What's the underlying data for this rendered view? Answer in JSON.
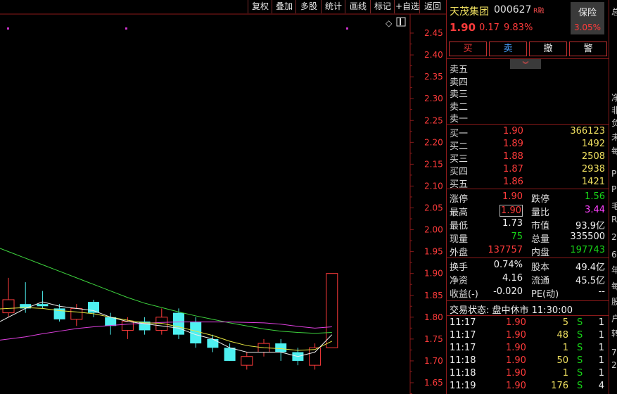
{
  "toolbar": {
    "buttons": [
      "复权",
      "叠加",
      "多股",
      "统计",
      "画线",
      "标记",
      "+自选",
      "返回"
    ]
  },
  "stock": {
    "name": "天茂集团",
    "code": "000627",
    "tag": "R融",
    "badge": "保险",
    "badge_pct": "3.05%",
    "price": "1.90",
    "change": "0.17",
    "change_pct": "9.83%"
  },
  "trade_buttons": [
    "买",
    "卖",
    "撤",
    "警"
  ],
  "order_book": {
    "asks": [
      "卖五",
      "卖四",
      "卖三",
      "卖二",
      "卖一"
    ],
    "bids": [
      {
        "label": "买一",
        "price": "1.90",
        "vol": "366123"
      },
      {
        "label": "买二",
        "price": "1.89",
        "vol": "1492"
      },
      {
        "label": "买三",
        "price": "1.88",
        "vol": "2508"
      },
      {
        "label": "买四",
        "price": "1.87",
        "vol": "2938"
      },
      {
        "label": "买五",
        "price": "1.86",
        "vol": "1421"
      }
    ]
  },
  "stats": [
    {
      "l1": "涨停",
      "v1": "1.90",
      "c1": "red",
      "l2": "跌停",
      "v2": "1.56",
      "c2": "green"
    },
    {
      "l1": "最高",
      "v1": "1.90",
      "c1": "red",
      "l2": "量比",
      "v2": "3.44",
      "c2": "magenta"
    },
    {
      "l1": "最低",
      "v1": "1.73",
      "c1": "white",
      "l2": "市值",
      "v2": "93.9亿",
      "c2": "white"
    },
    {
      "l1": "现量",
      "v1": "75",
      "c1": "green",
      "l2": "总量",
      "v2": "335500",
      "c2": "white"
    },
    {
      "l1": "外盘",
      "v1": "137757",
      "c1": "red",
      "l2": "内盘",
      "v2": "197743",
      "c2": "green"
    }
  ],
  "fund": [
    {
      "l1": "换手",
      "v1": "0.74%",
      "l2": "股本",
      "v2": "49.4亿"
    },
    {
      "l1": "净资",
      "v1": "4.16",
      "l2": "流通",
      "v2": "45.5亿"
    },
    {
      "l1": "收益(-)",
      "v1": "-0.020",
      "l2": "PE(动)",
      "v2": "--"
    }
  ],
  "trade_status": "交易状态: 盘中休市 11:30:00",
  "ticks": [
    {
      "time": "11:17",
      "price": "1.90",
      "vol": "5",
      "side": "S",
      "n": "1"
    },
    {
      "time": "11:17",
      "price": "1.90",
      "vol": "48",
      "side": "S",
      "n": "1"
    },
    {
      "time": "11:17",
      "price": "1.90",
      "vol": "1",
      "side": "S",
      "n": "1"
    },
    {
      "time": "11:18",
      "price": "1.90",
      "vol": "50",
      "side": "S",
      "n": "1"
    },
    {
      "time": "11:18",
      "price": "1.90",
      "vol": "1",
      "side": "S",
      "n": "1"
    },
    {
      "time": "11:19",
      "price": "1.90",
      "vol": "176",
      "side": "S",
      "n": "4"
    }
  ],
  "far_right": [
    "总",
    "净",
    "非",
    "负",
    "未",
    "每",
    "P",
    "P",
    "毛",
    "R",
    "2",
    "6",
    "年",
    "每",
    "股",
    "户",
    "转",
    "7",
    "2"
  ],
  "chart_data": {
    "type": "candlestick",
    "ylim": [
      1.63,
      2.49
    ],
    "y_ticks": [
      "2.45",
      "2.40",
      "2.35",
      "2.30",
      "2.25",
      "2.20",
      "2.15",
      "2.10",
      "2.05",
      "2.00",
      "1.95",
      "1.90",
      "1.85",
      "1.80",
      "1.75",
      "1.70",
      "1.65"
    ],
    "candles": [
      {
        "o": 1.81,
        "c": 1.84,
        "h": 1.89,
        "l": 1.8
      },
      {
        "o": 1.83,
        "c": 1.82,
        "h": 1.88,
        "l": 1.81
      },
      {
        "o": 1.83,
        "c": 1.825,
        "h": 1.86,
        "l": 1.82
      },
      {
        "o": 1.82,
        "c": 1.795,
        "h": 1.83,
        "l": 1.79
      },
      {
        "o": 1.795,
        "c": 1.82,
        "h": 1.83,
        "l": 1.78
      },
      {
        "o": 1.835,
        "c": 1.81,
        "h": 1.84,
        "l": 1.8
      },
      {
        "o": 1.8,
        "c": 1.78,
        "h": 1.81,
        "l": 1.76
      },
      {
        "o": 1.77,
        "c": 1.79,
        "h": 1.8,
        "l": 1.75
      },
      {
        "o": 1.79,
        "c": 1.77,
        "h": 1.8,
        "l": 1.76
      },
      {
        "o": 1.77,
        "c": 1.8,
        "h": 1.82,
        "l": 1.76
      },
      {
        "o": 1.81,
        "c": 1.76,
        "h": 1.82,
        "l": 1.75
      },
      {
        "o": 1.79,
        "c": 1.74,
        "h": 1.8,
        "l": 1.73
      },
      {
        "o": 1.75,
        "c": 1.73,
        "h": 1.76,
        "l": 1.72
      },
      {
        "o": 1.73,
        "c": 1.7,
        "h": 1.74,
        "l": 1.7
      },
      {
        "o": 1.69,
        "c": 1.71,
        "h": 1.72,
        "l": 1.68
      },
      {
        "o": 1.72,
        "c": 1.74,
        "h": 1.75,
        "l": 1.71
      },
      {
        "o": 1.74,
        "c": 1.72,
        "h": 1.75,
        "l": 1.7
      },
      {
        "o": 1.72,
        "c": 1.7,
        "h": 1.73,
        "l": 1.69
      },
      {
        "o": 1.69,
        "c": 1.73,
        "h": 1.74,
        "l": 1.68
      },
      {
        "o": 1.73,
        "c": 1.9,
        "h": 1.9,
        "l": 1.73
      }
    ],
    "ma_green": [
      1.95,
      1.935,
      1.92,
      1.905,
      1.89,
      1.875,
      1.86,
      1.845,
      1.832,
      1.822,
      1.812,
      1.803,
      1.795,
      1.787,
      1.78,
      1.773,
      1.768,
      1.765,
      1.763,
      1.765
    ],
    "ma_magenta": [
      1.75,
      1.755,
      1.762,
      1.768,
      1.774,
      1.778,
      1.781,
      1.784,
      1.786,
      1.788,
      1.789,
      1.789,
      1.789,
      1.789,
      1.788,
      1.787,
      1.784,
      1.779,
      1.775,
      1.778
    ],
    "ma_yellow": [
      1.82,
      1.822,
      1.82,
      1.815,
      1.812,
      1.808,
      1.8,
      1.793,
      1.787,
      1.786,
      1.778,
      1.768,
      1.758,
      1.745,
      1.735,
      1.73,
      1.728,
      1.724,
      1.726,
      1.745
    ],
    "ma_white": [
      1.8,
      1.82,
      1.835,
      1.825,
      1.82,
      1.815,
      1.8,
      1.79,
      1.785,
      1.78,
      1.775,
      1.76,
      1.75,
      1.73,
      1.72,
      1.72,
      1.72,
      1.71,
      1.72,
      1.76
    ]
  }
}
